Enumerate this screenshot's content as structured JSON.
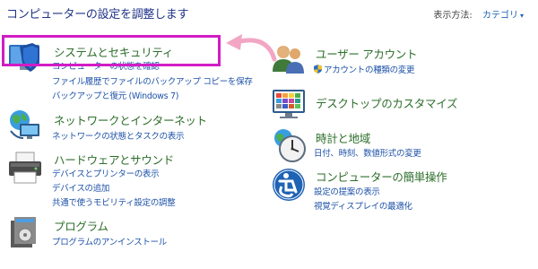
{
  "page": {
    "title": "コンピューターの設定を調整します",
    "view_by_label": "表示方法:",
    "view_by_value": "カテゴリ"
  },
  "categories": [
    {
      "icon": "shield-monitor-icon",
      "title": "システムとセキュリティ",
      "links": [
        "コンピューターの状態を確認",
        "ファイル履歴でファイルのバックアップ コピーを保存",
        "バックアップと復元 (Windows 7)"
      ],
      "highlighted": true
    },
    {
      "icon": "network-globe-icon",
      "title": "ネットワークとインターネット",
      "links": [
        "ネットワークの状態とタスクの表示"
      ]
    },
    {
      "icon": "printer-icon",
      "title": "ハードウェアとサウンド",
      "links": [
        "デバイスとプリンターの表示",
        "デバイスの追加",
        "共通で使うモビリティ設定の調整"
      ]
    },
    {
      "icon": "programs-icon",
      "title": "プログラム",
      "links": [
        "プログラムのアンインストール"
      ]
    },
    {
      "icon": "users-icon",
      "title": "ユーザー アカウント",
      "links": [
        "アカウントの種類の変更"
      ]
    },
    {
      "icon": "desktop-customize-icon",
      "title": "デスクトップのカスタマイズ",
      "links": []
    },
    {
      "icon": "clock-globe-icon",
      "title": "時計と地域",
      "links": [
        "日付、時刻、数値形式の変更"
      ]
    },
    {
      "icon": "ease-of-access-icon",
      "title": "コンピューターの簡単操作",
      "links": [
        "設定の提案の表示",
        "視覚ディスプレイの最適化"
      ]
    }
  ],
  "colors": {
    "title": "#1e3287",
    "category": "#2d6e2b",
    "link": "#1e52a8",
    "highlight": "#d21cc5",
    "arrow": "#f2a6c4"
  }
}
